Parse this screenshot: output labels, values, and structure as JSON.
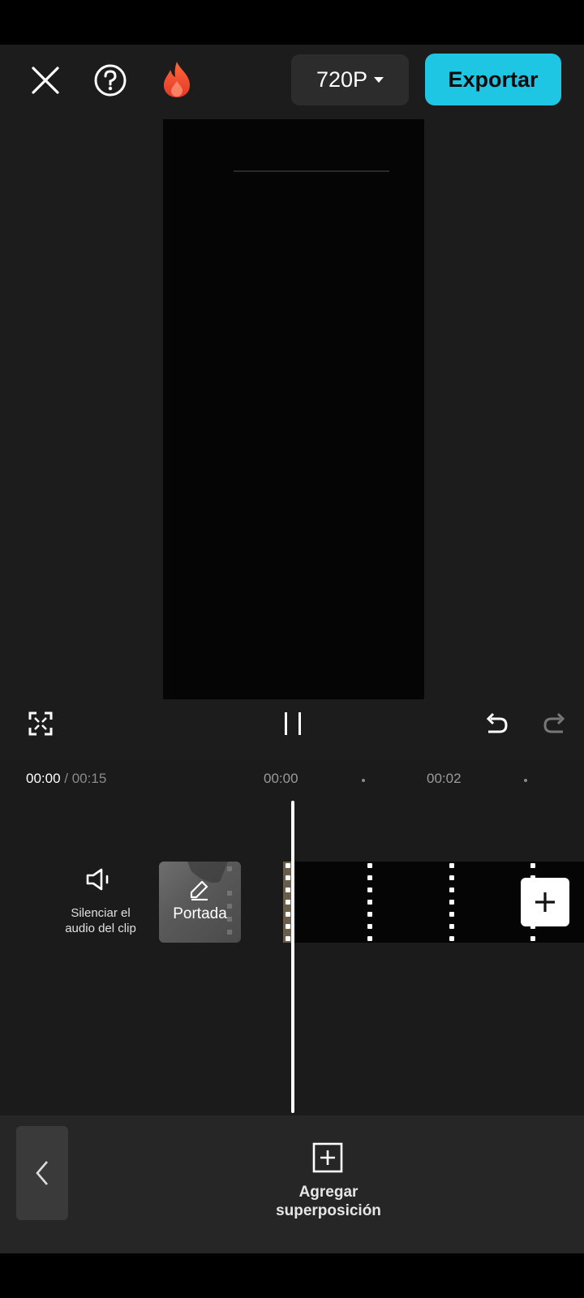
{
  "header": {
    "resolution_label": "720P",
    "export_label": "Exportar",
    "accent_color": "#1fc6e4"
  },
  "icons": {
    "close": "close-icon",
    "help": "help-icon",
    "flame": "flame-icon",
    "fullscreen": "fullscreen-icon",
    "pause": "pause-icon",
    "undo": "undo-icon",
    "redo": "redo-icon",
    "speaker": "speaker-icon",
    "edit": "pencil-icon",
    "add": "plus-icon",
    "back": "chevron-left-icon",
    "overlay": "add-overlay-icon"
  },
  "timeline": {
    "current_time": "00:00",
    "total_time": "/ 00:15",
    "ticks": [
      "00:00",
      "00:02"
    ]
  },
  "track": {
    "mute_label_line1": "Silenciar el",
    "mute_label_line2": "audio del clip",
    "cover_label": "Portada"
  },
  "toolbar": {
    "overlay_label_line1": "Agregar",
    "overlay_label_line2": "superposición"
  }
}
